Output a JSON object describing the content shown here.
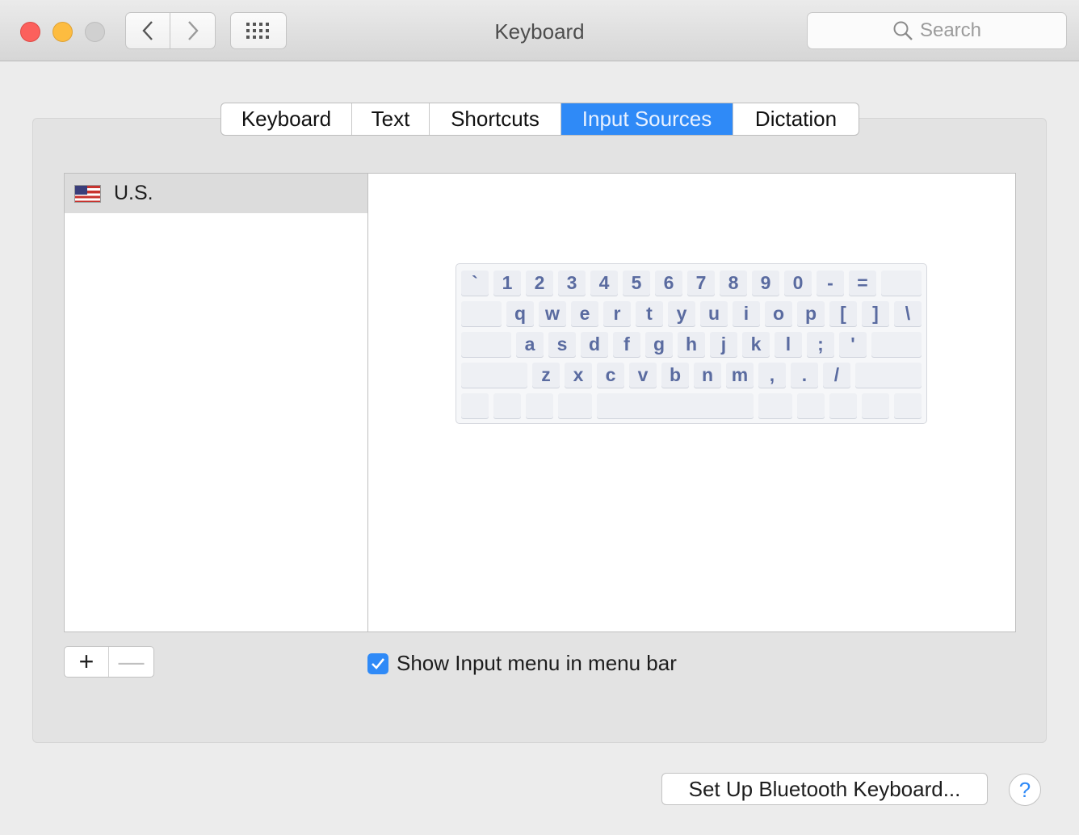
{
  "window": {
    "title": "Keyboard"
  },
  "toolbar": {
    "search_placeholder": "Search"
  },
  "tabs": [
    {
      "label": "Keyboard",
      "active": false
    },
    {
      "label": "Text",
      "active": false
    },
    {
      "label": "Shortcuts",
      "active": false
    },
    {
      "label": "Input Sources",
      "active": true
    },
    {
      "label": "Dictation",
      "active": false
    }
  ],
  "input_sources": [
    {
      "label": "U.S.",
      "icon": "us-flag-icon",
      "selected": true
    }
  ],
  "keyboard_rows": [
    [
      "`",
      "1",
      "2",
      "3",
      "4",
      "5",
      "6",
      "7",
      "8",
      "9",
      "0",
      "-",
      "="
    ],
    [
      "q",
      "w",
      "e",
      "r",
      "t",
      "y",
      "u",
      "i",
      "o",
      "p",
      "[",
      "]",
      "\\"
    ],
    [
      "a",
      "s",
      "d",
      "f",
      "g",
      "h",
      "j",
      "k",
      "l",
      ";",
      "'"
    ],
    [
      "z",
      "x",
      "c",
      "v",
      "b",
      "n",
      "m",
      ",",
      ".",
      "/"
    ]
  ],
  "controls": {
    "add_label": "+",
    "remove_label": "—",
    "show_input_menu_label": "Show Input menu in menu bar",
    "show_input_menu_checked": true,
    "bluetooth_button": "Set Up Bluetooth Keyboard...",
    "help_label": "?"
  },
  "colors": {
    "accent": "#2f8af7",
    "key_text": "#5a6ba0"
  }
}
